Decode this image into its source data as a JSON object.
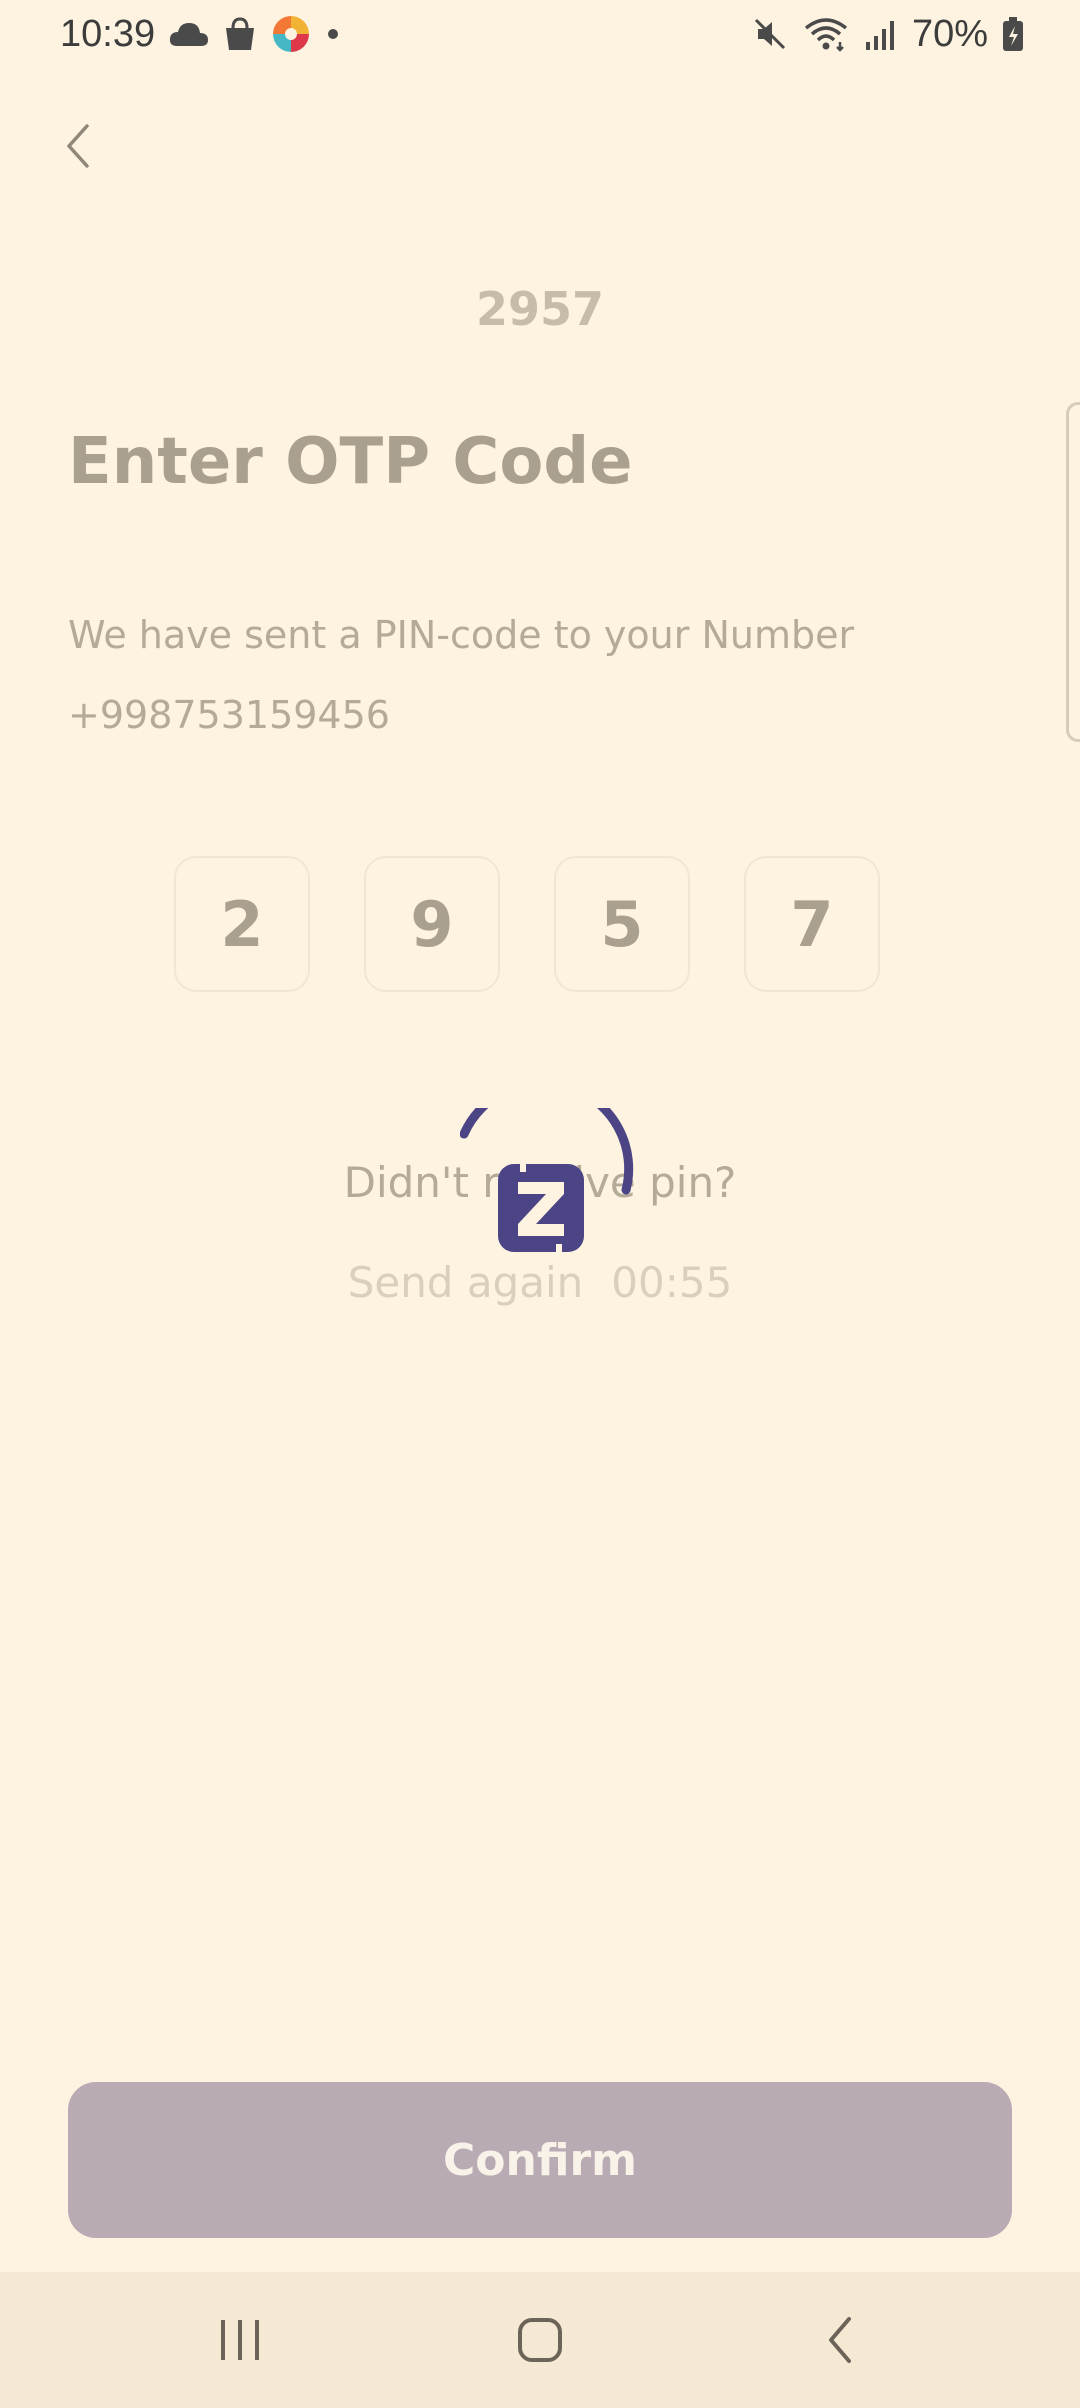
{
  "status_bar": {
    "time": "10:39",
    "battery": "70%",
    "icons": [
      "cloud-icon",
      "shopping-bag-icon",
      "app-color-icon",
      "dot-icon",
      "mute-icon",
      "wifi-icon",
      "signal-icon",
      "battery-icon"
    ]
  },
  "header": {
    "otp_hint": "2957"
  },
  "main": {
    "title": "Enter OTP Code",
    "subtitle": "We have sent a PIN-code to your Number",
    "phone": "+998753159456",
    "otp_digits": [
      "2",
      "9",
      "5",
      "7"
    ],
    "resend_question": "Didn't receive pin?",
    "resend_label": "Send again",
    "countdown": "00:55"
  },
  "footer": {
    "confirm_label": "Confirm"
  },
  "colors": {
    "background": "#fdf3e0",
    "accent": "#4b4585",
    "button": "#b8abb4"
  }
}
